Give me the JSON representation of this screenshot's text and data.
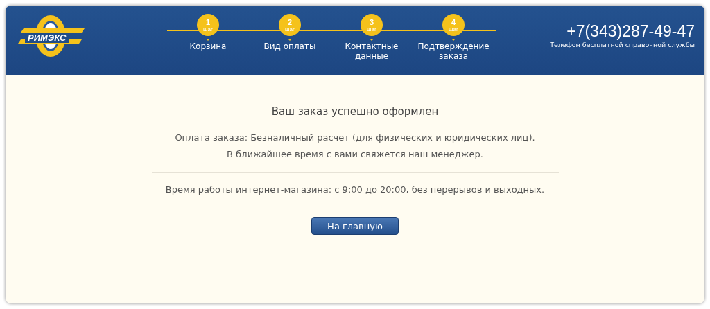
{
  "logo": {
    "text": "РИМЭКС"
  },
  "steps": [
    {
      "number": "1",
      "unit": "шаг",
      "label": "Корзина"
    },
    {
      "number": "2",
      "unit": "шаг",
      "label": "Вид оплаты"
    },
    {
      "number": "3",
      "unit": "шаг",
      "label": "Контактные данные"
    },
    {
      "number": "4",
      "unit": "шаг",
      "label": "Подтверждение заказа"
    }
  ],
  "phone": {
    "number": "+7(343)287-49-47",
    "caption": "Телефон бесплатной справочной службы"
  },
  "message": {
    "title": "Ваш заказ успешно оформлен",
    "lines": [
      "Оплата заказа: Безналичный расчет (для физических и юридических лиц).",
      "В ближайшее время с вами свяжется наш менеджер."
    ],
    "hours": "Время работы интернет-магазина: с 9:00 до 20:00, без перерывов и выходных."
  },
  "buttons": [
    "На главную"
  ]
}
